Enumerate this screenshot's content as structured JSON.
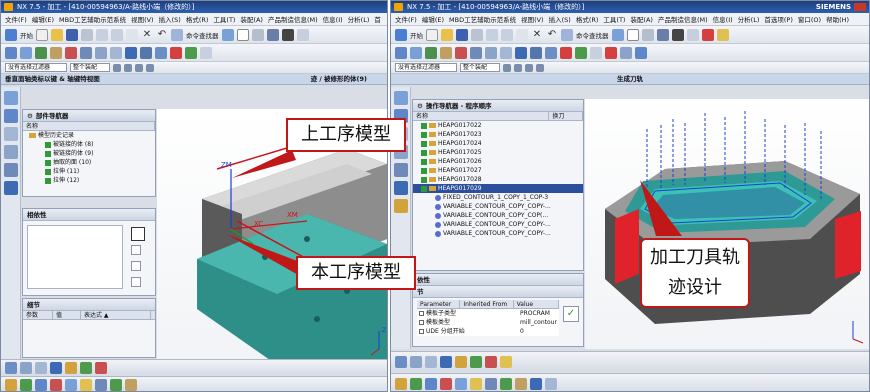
{
  "left_window": {
    "title": "NX 7.5 - 加工 - [410-00594963/A-路线小端（修改的）]",
    "menu": [
      "文件(F)",
      "编辑(E)",
      "MBD工艺辅助示范系统",
      "视图(V)",
      "插入(S)",
      "格式(R)",
      "工具(T)",
      "装配(A)",
      "产品制造信息(M)",
      "信息(I)",
      "分析(L)",
      "首"
    ],
    "toolbar_start_label": "开始",
    "toolbar_cmd_finder": "命令查找器",
    "filter_select": "没有选择过滤器",
    "assembly_select": "整个装配",
    "caption_left": "垂直面轴类标以键 & 轴键特视图",
    "caption_right": "迹 / 被修形的体(9)",
    "part_navigator": {
      "header": "部件导航器",
      "column_name": "名称",
      "items": [
        {
          "label": "模型历史记录"
        },
        {
          "label": "被链接的体 (8)"
        },
        {
          "label": "被链接的体 (9)"
        },
        {
          "label": "抽取的面 (10)"
        },
        {
          "label": "拉伸 (11)"
        },
        {
          "label": "拉伸 (12)"
        }
      ]
    },
    "dependency_header": "相依性",
    "details": {
      "header": "细节",
      "col_param": "参数",
      "col_value": "值",
      "col_expr": "表达式 ▲"
    },
    "axis_labels": {
      "zm": "ZM",
      "xc": "XC",
      "xm": "XM",
      "z": "Z"
    }
  },
  "right_window": {
    "title": "NX 7.5 - 加工 - [410-00594963/A-路线小端（修改的）]",
    "brand": "SIEMENS",
    "menu": [
      "文件(F)",
      "编辑(E)",
      "MBD工艺辅助示范系统",
      "视图(V)",
      "插入(S)",
      "格式(R)",
      "工具(T)",
      "装配(A)",
      "产品制造信息(M)",
      "信息(I)",
      "分析(L)",
      "首选项(P)",
      "窗口(O)",
      "帮助(H)"
    ],
    "toolbar_start_label": "开始",
    "toolbar_cmd_finder": "命令查找器",
    "filter_select": "没有选择过滤器",
    "assembly_select": "整个装配",
    "viewport_caption": "生成刀轨",
    "operation_navigator": {
      "header": "操作导航器 - 程序顺序",
      "column_name": "名称",
      "column_toolchange": "换刀",
      "items": [
        {
          "label": "HEAPG017022",
          "kind": "group"
        },
        {
          "label": "HEAPG017023",
          "kind": "group"
        },
        {
          "label": "HEAPG017024",
          "kind": "group"
        },
        {
          "label": "HEAPG017025",
          "kind": "group"
        },
        {
          "label": "HEAPG017026",
          "kind": "group"
        },
        {
          "label": "HEAPG017027",
          "kind": "group"
        },
        {
          "label": "HEAPG017028",
          "kind": "group"
        },
        {
          "label": "HEAPG017029",
          "kind": "group-selected"
        },
        {
          "label": "FIXED_CONTOUR_1_COPY_1_COP-3",
          "kind": "op"
        },
        {
          "label": "VARIABLE_CONTOUR_COPY_COPY-...",
          "kind": "op"
        },
        {
          "label": "VARIABLE_CONTOUR_COPY_COP(...",
          "kind": "op"
        },
        {
          "label": "VARIABLE_CONTOUR_COPY_COPY-...",
          "kind": "op"
        },
        {
          "label": "VARIABLE_CONTOUR_COPY_COPY-...",
          "kind": "op"
        }
      ]
    },
    "dependency_header": "依性",
    "details": {
      "header": "节",
      "col_param": "Parameter",
      "col_inherited": "Inherited From",
      "col_value": "Value",
      "rows": [
        {
          "param": "模板子类型",
          "value": "PROCRAM"
        },
        {
          "param": "模板类型",
          "value": "mill_contour"
        },
        {
          "param": "UDE 分组开始",
          "value": "0"
        }
      ]
    }
  },
  "callouts": {
    "upper_model": "上工序模型",
    "current_model": "本工序模型",
    "toolpath_design": "加工刀具轨\n迹设计"
  }
}
